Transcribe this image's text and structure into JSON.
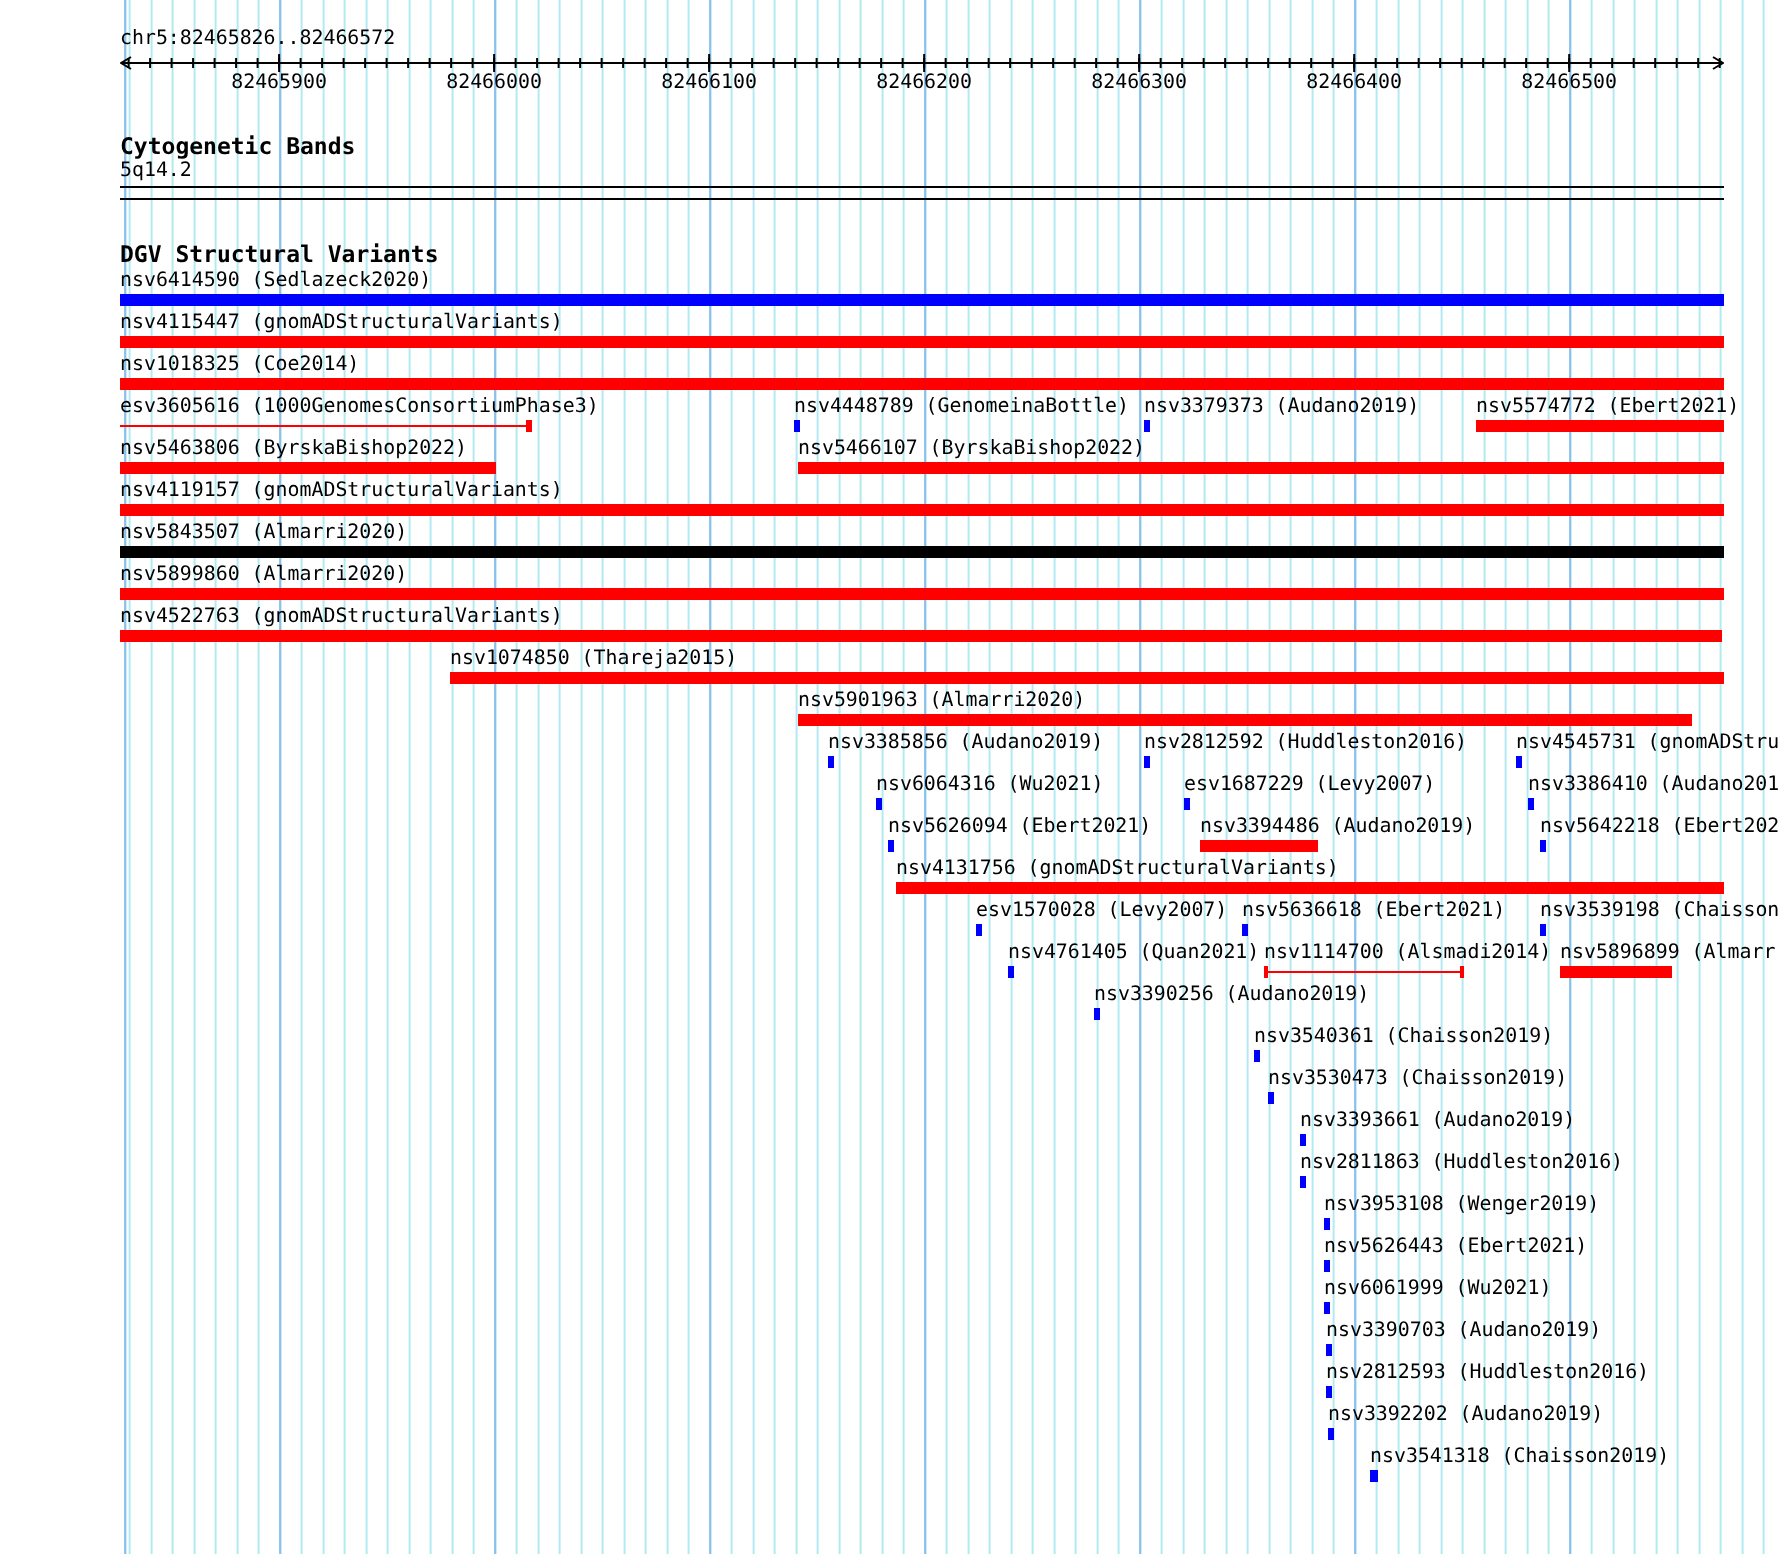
{
  "ruler": {
    "location": "chr5:82465826..82466572",
    "ticks": [
      "82465900",
      "82466000",
      "82466100",
      "82466200",
      "82466300",
      "82466400",
      "82466500"
    ]
  },
  "cytogenetic_bands": {
    "title": "Cytogenetic Bands",
    "bands": [
      {
        "label": "5q14.2"
      }
    ]
  },
  "dgv_structural_variants": {
    "title": "DGV Structural Variants",
    "rows": [
      {
        "features": [
          {
            "label": "nsv6414590 (Sedlazeck2020)",
            "kind": "bar",
            "color": "#0000ff"
          }
        ]
      },
      {
        "features": [
          {
            "label": "nsv4115447 (gnomADStructuralVariants)",
            "kind": "bar",
            "color": "#ff0000"
          }
        ]
      },
      {
        "features": [
          {
            "label": "nsv1018325 (Coe2014)",
            "kind": "bar",
            "color": "#ff0000"
          }
        ]
      },
      {
        "features": [
          {
            "label": "esv3605616 (1000GenomesConsortiumPhase3)",
            "kind": "line",
            "color": "#ff0000"
          },
          {
            "label": "nsv4448789 (GenomeinaBottle)",
            "kind": "bar",
            "color": "#0000ff"
          },
          {
            "label": "nsv3379373 (Audano2019)",
            "kind": "bar",
            "color": "#0000ff"
          },
          {
            "label": "nsv5574772 (Ebert2021)",
            "kind": "bar",
            "color": "#ff0000"
          }
        ]
      },
      {
        "features": [
          {
            "label": "nsv5463806 (ByrskaBishop2022)",
            "kind": "bar",
            "color": "#ff0000"
          },
          {
            "label": "nsv5466107 (ByrskaBishop2022)",
            "kind": "bar",
            "color": "#ff0000"
          }
        ]
      },
      {
        "features": [
          {
            "label": "nsv4119157 (gnomADStructuralVariants)",
            "kind": "bar",
            "color": "#ff0000"
          }
        ]
      },
      {
        "features": [
          {
            "label": "nsv5843507 (Almarri2020)",
            "kind": "bar",
            "color": "#000000"
          }
        ]
      },
      {
        "features": [
          {
            "label": "nsv5899860 (Almarri2020)",
            "kind": "bar",
            "color": "#ff0000"
          }
        ]
      },
      {
        "features": [
          {
            "label": "nsv4522763 (gnomADStructuralVariants)",
            "kind": "bar",
            "color": "#ff0000"
          }
        ]
      },
      {
        "features": [
          {
            "label": "nsv1074850 (Thareja2015)",
            "kind": "bar",
            "color": "#ff0000"
          }
        ]
      },
      {
        "features": [
          {
            "label": "nsv5901963 (Almarri2020)",
            "kind": "bar",
            "color": "#ff0000"
          }
        ]
      },
      {
        "features": [
          {
            "label": "nsv3385856 (Audano2019)",
            "kind": "bar",
            "color": "#0000ff"
          },
          {
            "label": "nsv2812592 (Huddleston2016)",
            "kind": "bar",
            "color": "#0000ff"
          },
          {
            "label": "nsv4545731 (gnomADStru",
            "kind": "bar",
            "color": "#0000ff"
          }
        ]
      },
      {
        "features": [
          {
            "label": "nsv6064316 (Wu2021)",
            "kind": "bar",
            "color": "#0000ff"
          },
          {
            "label": "esv1687229 (Levy2007)",
            "kind": "bar",
            "color": "#0000ff"
          },
          {
            "label": "nsv3386410 (Audano201",
            "kind": "bar",
            "color": "#0000ff"
          }
        ]
      },
      {
        "features": [
          {
            "label": "nsv5626094 (Ebert2021)",
            "kind": "bar",
            "color": "#0000ff"
          },
          {
            "label": "nsv3394486 (Audano2019)",
            "kind": "bar",
            "color": "#ff0000"
          },
          {
            "label": "nsv5642218 (Ebert202",
            "kind": "bar",
            "color": "#0000ff"
          }
        ]
      },
      {
        "features": [
          {
            "label": "nsv4131756 (gnomADStructuralVariants)",
            "kind": "bar",
            "color": "#ff0000"
          }
        ]
      },
      {
        "features": [
          {
            "label": "esv1570028 (Levy2007)",
            "kind": "bar",
            "color": "#0000ff"
          },
          {
            "label": "nsv5636618 (Ebert2021)",
            "kind": "bar",
            "color": "#0000ff"
          },
          {
            "label": "nsv3539198 (Chaisson",
            "kind": "bar",
            "color": "#0000ff"
          }
        ]
      },
      {
        "features": [
          {
            "label": "nsv4761405 (Quan2021)",
            "kind": "bar",
            "color": "#0000ff"
          },
          {
            "label": "nsv1114700 (Alsmadi2014)",
            "kind": "line",
            "color": "#ff0000"
          },
          {
            "label": "nsv5896899 (Almarr",
            "kind": "bar",
            "color": "#ff0000"
          }
        ]
      },
      {
        "features": [
          {
            "label": "nsv3390256 (Audano2019)",
            "kind": "bar",
            "color": "#0000ff"
          }
        ]
      },
      {
        "features": [
          {
            "label": "nsv3540361 (Chaisson2019)",
            "kind": "bar",
            "color": "#0000ff"
          }
        ]
      },
      {
        "features": [
          {
            "label": "nsv3530473 (Chaisson2019)",
            "kind": "bar",
            "color": "#0000ff"
          }
        ]
      },
      {
        "features": [
          {
            "label": "nsv3393661 (Audano2019)",
            "kind": "bar",
            "color": "#0000ff"
          }
        ]
      },
      {
        "features": [
          {
            "label": "nsv2811863 (Huddleston2016)",
            "kind": "bar",
            "color": "#0000ff"
          }
        ]
      },
      {
        "features": [
          {
            "label": "nsv3953108 (Wenger2019)",
            "kind": "bar",
            "color": "#0000ff"
          }
        ]
      },
      {
        "features": [
          {
            "label": "nsv5626443 (Ebert2021)",
            "kind": "bar",
            "color": "#0000ff"
          }
        ]
      },
      {
        "features": [
          {
            "label": "nsv6061999 (Wu2021)",
            "kind": "bar",
            "color": "#0000ff"
          }
        ]
      },
      {
        "features": [
          {
            "label": "nsv3390703 (Audano2019)",
            "kind": "bar",
            "color": "#0000ff"
          }
        ]
      },
      {
        "features": [
          {
            "label": "nsv2812593 (Huddleston2016)",
            "kind": "bar",
            "color": "#0000ff"
          }
        ]
      },
      {
        "features": [
          {
            "label": "nsv3392202 (Audano2019)",
            "kind": "bar",
            "color": "#0000ff"
          }
        ]
      },
      {
        "features": [
          {
            "label": "nsv3541318 (Chaisson2019)",
            "kind": "bar",
            "color": "#0000ff"
          }
        ]
      }
    ]
  }
}
